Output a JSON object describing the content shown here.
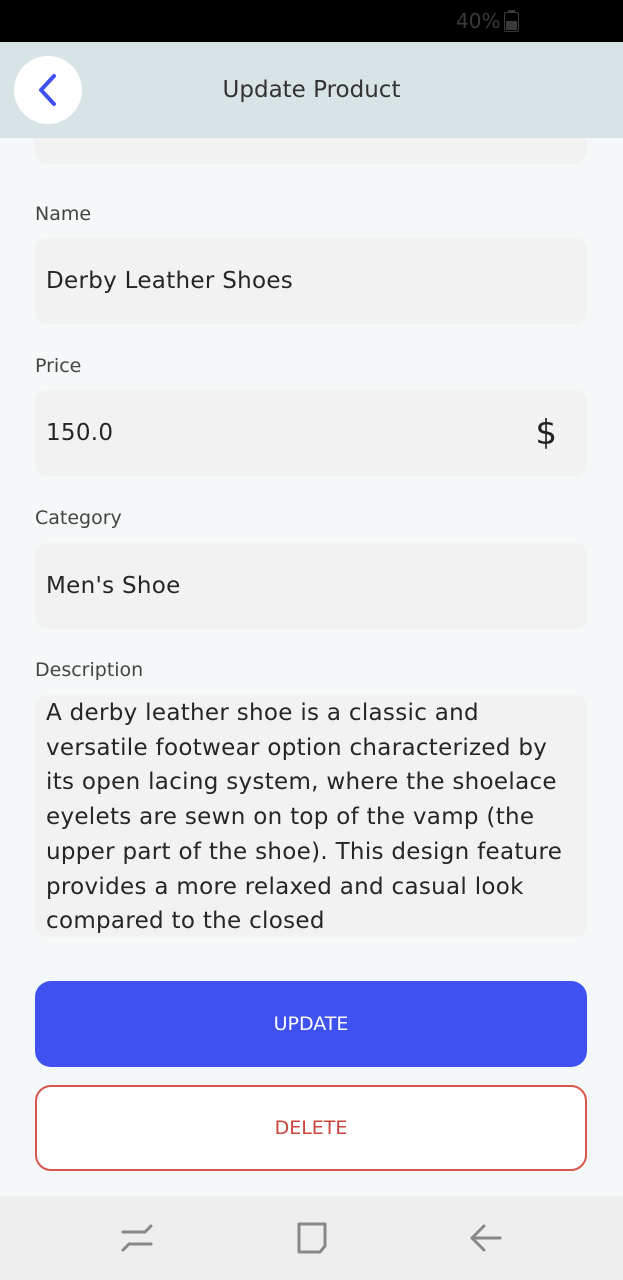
{
  "status_bar": {
    "battery_text": "40%",
    "battery_icon": "battery-icon"
  },
  "app_bar": {
    "title": "Update Product",
    "back_icon": "chevron-left-icon",
    "accent_color": "#3f51f0"
  },
  "form": {
    "name": {
      "label": "Name",
      "value": "Derby Leather Shoes"
    },
    "price": {
      "label": "Price",
      "value": "150.0",
      "suffix_icon": "$"
    },
    "category": {
      "label": "Category",
      "value": "Men's Shoe"
    },
    "description": {
      "label": "Description",
      "value": "A derby leather shoe is a classic and versatile footwear option characterized by its open lacing system, where the shoelace eyelets are sewn on top of the vamp (the upper part of the shoe). This design feature provides a more relaxed and casual look compared to the closed"
    }
  },
  "actions": {
    "update_label": "UPDATE",
    "delete_label": "DELETE",
    "update_color": "#3f51f0",
    "delete_color": "#d9574c"
  },
  "nav_bar": {
    "recents_icon": "recents-icon",
    "home_icon": "home-icon",
    "back_icon": "back-arrow-icon"
  }
}
